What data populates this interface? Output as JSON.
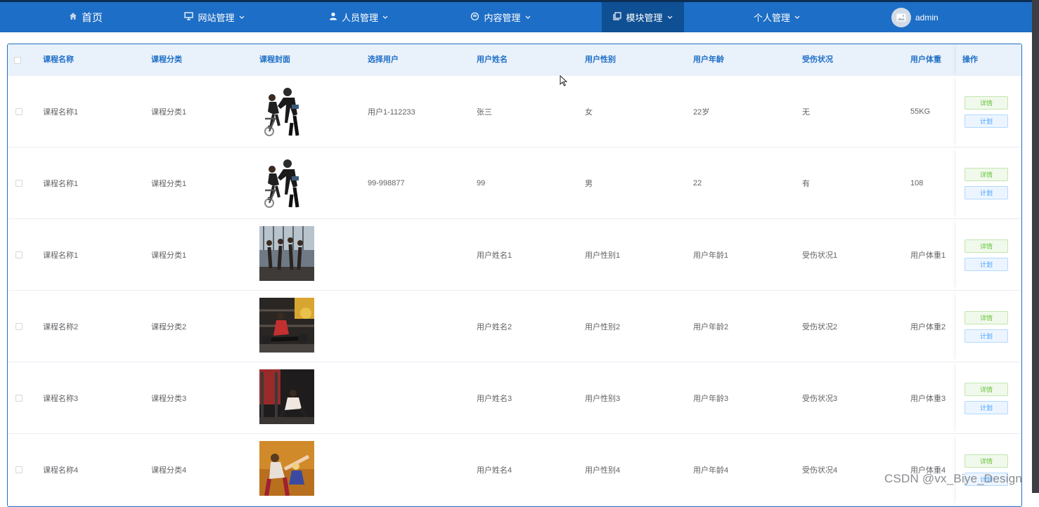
{
  "nav": {
    "items": [
      {
        "label": "首页",
        "icon": "home-icon"
      },
      {
        "label": "网站管理",
        "icon": "monitor-icon"
      },
      {
        "label": "人员管理",
        "icon": "user-icon"
      },
      {
        "label": "内容管理",
        "icon": "chat-icon"
      },
      {
        "label": "模块管理",
        "icon": "copy-icon"
      },
      {
        "label": "个人管理",
        "icon": ""
      }
    ],
    "username": "admin"
  },
  "table": {
    "columns": [
      "课程名称",
      "课程分类",
      "课程封面",
      "选择用户",
      "用户姓名",
      "用户性别",
      "用户年龄",
      "受伤状况",
      "用户体重",
      "操作"
    ],
    "detail_label": "详情",
    "plan_label": "计划",
    "rows": [
      {
        "name": "课程名称1",
        "category": "课程分类1",
        "user": "用户1-112233",
        "uname": "张三",
        "gender": "女",
        "age": "22岁",
        "injury": "无",
        "weight": "55KG",
        "cover": "fitness-couple-bike"
      },
      {
        "name": "课程名称1",
        "category": "课程分类1",
        "user": "99-998877",
        "uname": "99",
        "gender": "男",
        "age": "22",
        "injury": "有",
        "weight": "108",
        "cover": "fitness-couple-bike"
      },
      {
        "name": "课程名称1",
        "category": "课程分类1",
        "user": "",
        "uname": "用户姓名1",
        "gender": "用户性别1",
        "age": "用户年龄1",
        "injury": "受伤状况1",
        "weight": "用户体重1",
        "cover": "gym-class"
      },
      {
        "name": "课程名称2",
        "category": "课程分类2",
        "user": "",
        "uname": "用户姓名2",
        "gender": "用户性别2",
        "age": "用户年龄2",
        "injury": "受伤状况2",
        "weight": "用户体重2",
        "cover": "gym-trainer"
      },
      {
        "name": "课程名称3",
        "category": "课程分类3",
        "user": "",
        "uname": "用户姓名3",
        "gender": "用户性别3",
        "age": "用户年龄3",
        "injury": "受伤状况3",
        "weight": "用户体重3",
        "cover": "gym-machine"
      },
      {
        "name": "课程名称4",
        "category": "课程分类4",
        "user": "",
        "uname": "用户姓名4",
        "gender": "用户性别4",
        "age": "用户年龄4",
        "injury": "受伤状况4",
        "weight": "用户体重4",
        "cover": "aerobics"
      }
    ]
  },
  "watermark": "CSDN @vx_Biye_Design"
}
